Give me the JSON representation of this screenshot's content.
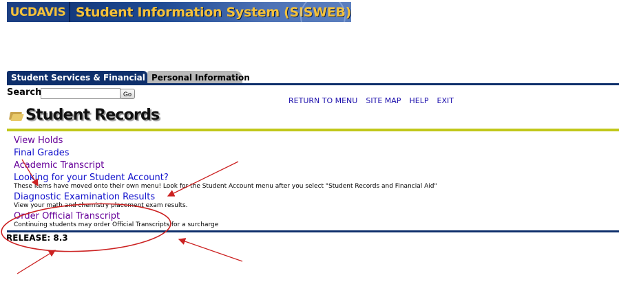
{
  "banner": {
    "logo": "UCDAVIS",
    "title": "Student Information System (SISWEB)"
  },
  "tabs": [
    {
      "label": "Student Services & Financial Aid",
      "active": true
    },
    {
      "label": "Personal Information",
      "active": false
    }
  ],
  "search": {
    "label": "Search",
    "value": "",
    "button": "Go"
  },
  "toplinks": [
    "RETURN TO MENU",
    "SITE MAP",
    "HELP",
    "EXIT"
  ],
  "page_title": "Student Records",
  "menu": {
    "view_holds": "View Holds",
    "final_grades": "Final Grades",
    "academic_transcript": "Academic Transcript",
    "student_account": "Looking for your Student Account?",
    "student_account_desc": "These items have moved onto their own menu! Look for the Student Account menu after you select \"Student Records and Financial Aid\"",
    "diagnostic": "Diagnostic Examination Results",
    "diagnostic_desc": "View your math and chemistry placement exam results.",
    "official_transcript": "Order Official Transcript",
    "official_transcript_desc": "Continuing students may order Official Transcripts for a surcharge"
  },
  "release": "RELEASE: 8.3",
  "colors": {
    "navy": "#0e2f6b",
    "olive": "#c1c81a",
    "annotation_red": "#cc2222",
    "visited": "#660099",
    "link": "#1111cc"
  }
}
